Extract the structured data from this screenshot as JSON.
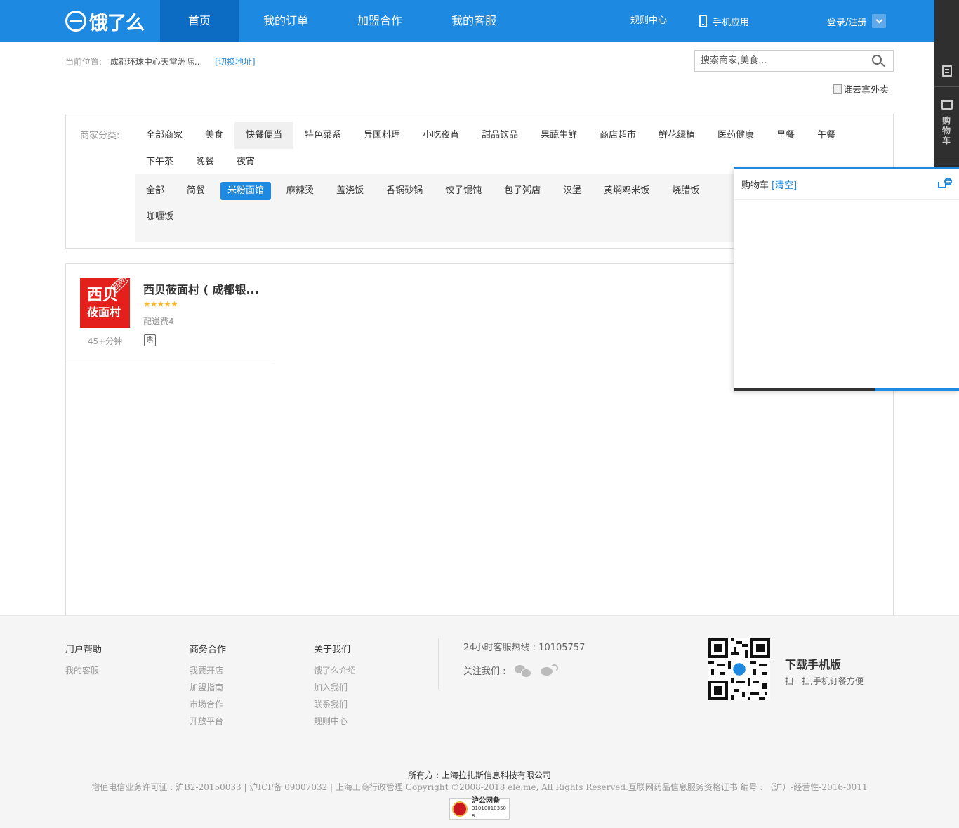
{
  "header": {
    "logo_text": "饿了么",
    "nav": [
      {
        "label": "首页",
        "active": true
      },
      {
        "label": "我的订单",
        "active": false
      },
      {
        "label": "加盟合作",
        "active": false
      },
      {
        "label": "我的客服",
        "active": false
      }
    ],
    "rules": "规则中心",
    "mobile_app": "手机应用",
    "login": "登录/注册",
    "brand_color": "#1e89e0"
  },
  "side": {
    "cart_label": "购物车"
  },
  "location": {
    "label": "当前位置:",
    "address": "成都环球中心天堂洲际...",
    "switch": "[切换地址]"
  },
  "search": {
    "placeholder": "搜索商家,美食..."
  },
  "ad": {
    "alt": "谁去拿外卖"
  },
  "categories": {
    "label": "商家分类:",
    "row1": [
      "全部商家",
      "美食",
      "快餐便当",
      "特色菜系",
      "异国料理",
      "小吃夜宵",
      "甜品饮品",
      "果蔬生鲜",
      "商店超市",
      "鲜花绿植",
      "医药健康",
      "早餐",
      "午餐"
    ],
    "row2": [
      "下午茶",
      "晚餐",
      "夜宵"
    ],
    "active": "快餐便当",
    "sub_row1": [
      "全部",
      "简餐",
      "米粉面馆",
      "麻辣烫",
      "盖浇饭",
      "香锅砂锅",
      "饺子馄饨",
      "包子粥店",
      "汉堡",
      "黄焖鸡米饭",
      "烧腊饭"
    ],
    "sub_row2": [
      "咖喱饭"
    ],
    "sub_active": "米粉面馆"
  },
  "shops": [
    {
      "name": "西贝莜面村 ( 成都银...",
      "logo_line1": "西贝",
      "logo_line2": "莜面村",
      "logo_badge": "品牌",
      "rating_stars": 5,
      "stars": "★★★★★",
      "delivery_fee": "配送费4",
      "delivery_time": "45+分钟",
      "invoice": "票"
    }
  ],
  "cart": {
    "title": "购物车",
    "clear": "[清空]"
  },
  "footer": {
    "columns": [
      {
        "title": "用户帮助",
        "links": [
          "我的客服"
        ]
      },
      {
        "title": "商务合作",
        "links": [
          "我要开店",
          "加盟指南",
          "市场合作",
          "开放平台"
        ]
      },
      {
        "title": "关于我们",
        "links": [
          "饿了么介绍",
          "加入我们",
          "联系我们",
          "规则中心"
        ]
      }
    ],
    "hotline": "24小时客服热线 : 10105757",
    "follow": "关注我们 :",
    "download_title": "下载手机版",
    "download_sub": "扫一扫,手机订餐方便",
    "owner": "所有方 : 上海拉扎斯信息科技有限公司",
    "legal": "增值电信业务许可证 : 沪B2-20150033 | 沪ICP备 09007032 | 上海工商行政管理 Copyright ©2008-2018 ele.me, All Rights Reserved.互联网药品信息服务资格证书 编号 : （沪）-经营性-2016-0011",
    "badge_line1": "沪公网备",
    "badge_line2": "31010010350​8"
  }
}
